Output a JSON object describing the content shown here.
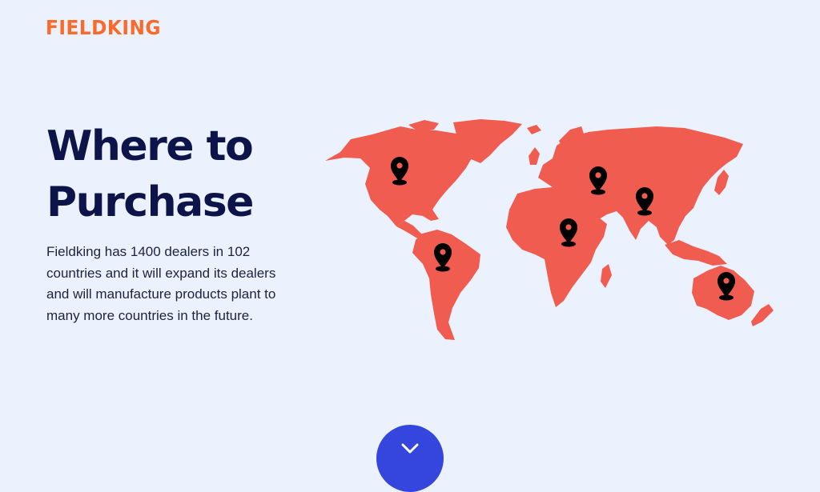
{
  "header": {
    "logo_text": "FIELDKING"
  },
  "hero": {
    "title_line1": "Where to",
    "title_line2": "Purchase",
    "description": "Fieldking has 1400 dealers in 102 countries and it will expand its dealers and will manufacture products plant to many more countries in the future."
  },
  "map": {
    "land_color": "#f05c50",
    "pin_color": "#000000",
    "pin_icon": "map-pin-icon"
  },
  "scroll_button": {
    "icon": "chevron-down-icon",
    "color": "#3546de"
  },
  "theme": {
    "background": "#ebf2fd",
    "logo_color": "#fb6a2a",
    "heading_color": "#0d144a"
  }
}
